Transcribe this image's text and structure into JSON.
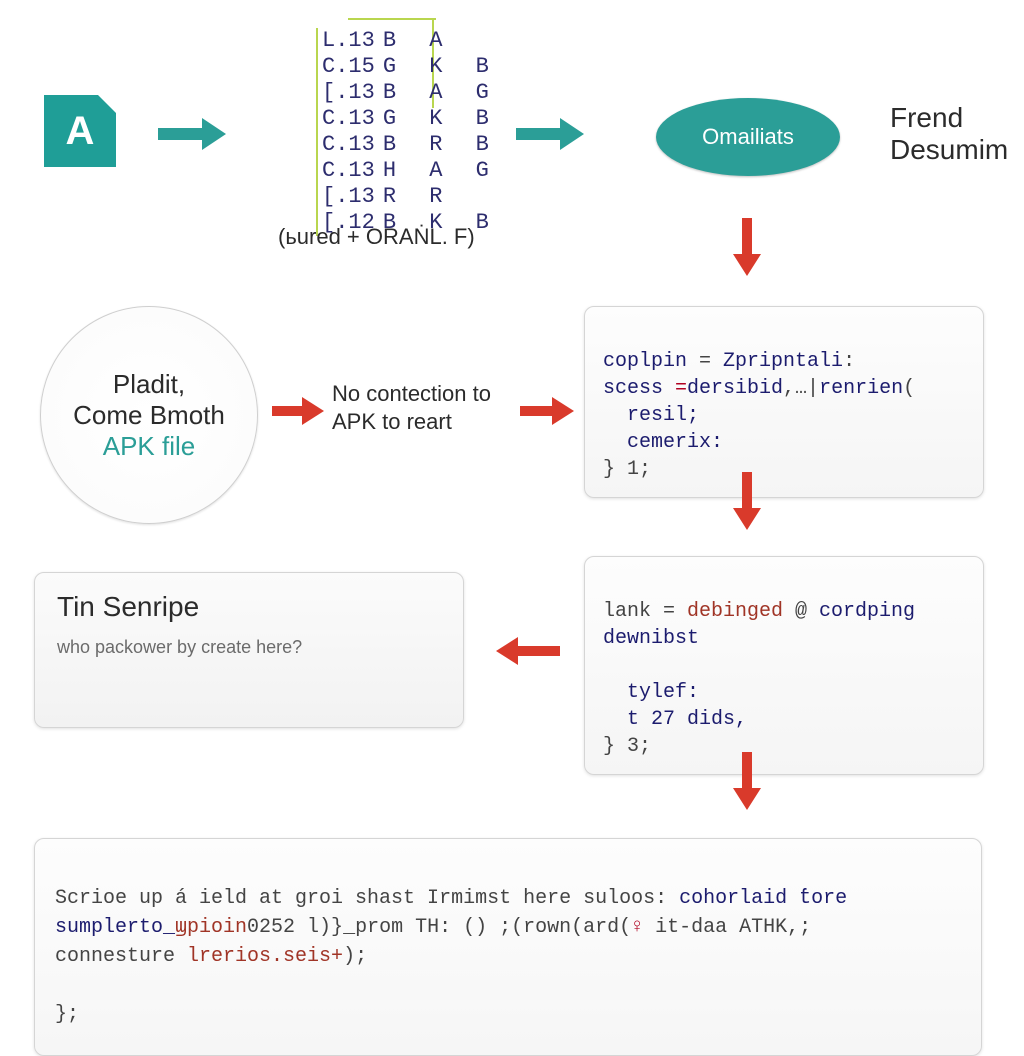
{
  "file_icon_letter": "A",
  "grid": {
    "rows": [
      {
        "idx": "L.13",
        "letters": "B A"
      },
      {
        "idx": "C.15",
        "letters": "G K B"
      },
      {
        "idx": "[.13",
        "letters": "B A G"
      },
      {
        "idx": "C.13",
        "letters": "G K B"
      },
      {
        "idx": "C.13",
        "letters": "B R B"
      },
      {
        "idx": "C.13",
        "letters": "H A G"
      },
      {
        "idx": "[.13",
        "letters": "R R"
      },
      {
        "idx": "[.12",
        "letters": "B K B"
      }
    ],
    "caption": "(ьured + ORAṄL. F)"
  },
  "ellipse_label": "Omailiats",
  "right_text": {
    "l1": "Frend",
    "l2": "Desumim"
  },
  "circle": {
    "l1": "Pladit,",
    "l2": "Come Bmoth",
    "l3": "APK file"
  },
  "mid_text": {
    "l1": "No contection to",
    "l2": "APK to reart"
  },
  "code1": {
    "line1_a": "coplpin",
    "line1_b": " = ",
    "line1_c": "Zpripntali",
    "line2_a": "scess ",
    "line2_b": "=",
    "line2_c": "dersibid",
    "line2_d": ",…|",
    "line2_e": "renrien",
    "line2_f": "(",
    "line3": "  resil;",
    "line4": "  cemerix:",
    "line5": "} 1;"
  },
  "tin": {
    "title": "Tin Senripe",
    "sub": "who раckower by create here?"
  },
  "code2": {
    "line1_a": "lank = ",
    "line1_b": "debinged",
    "line1_c": " @ ",
    "line1_d": "cordping",
    "line2": "dewnibst",
    "line3": "",
    "line4": "  tylef:",
    "line5": "  t 27 dids,",
    "line6": "} 3;"
  },
  "bottom": {
    "l1a": "Scrioe up á ield at groi shast Irmimst here suloos: ",
    "l1b": "cohorlaid ƭore",
    "l2a": "sumplerto_",
    "l2b": "ϣpioin",
    "l2c": "0252 l)}_prom TH: () ;(rown(ard(",
    "l2d": "♀",
    "l2e": " it-daa ATHK,;",
    "l3a": "connesture ",
    "l3b": "lrerios.seis+",
    "l3c": ");",
    "l4": "};"
  }
}
